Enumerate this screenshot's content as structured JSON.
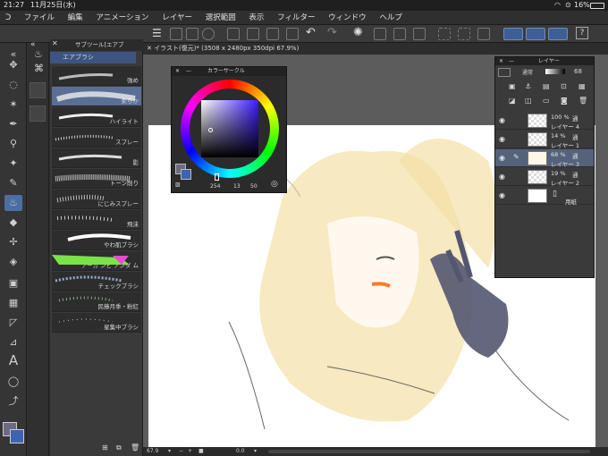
{
  "status": {
    "time": "21:27",
    "date": "11月25日(水)",
    "battery": "16%"
  },
  "menu": [
    "ファイル",
    "編集",
    "アニメーション",
    "レイヤー",
    "選択範囲",
    "表示",
    "フィルター",
    "ウィンドウ",
    "ヘルプ"
  ],
  "subtool_panel": {
    "header": "サブツール[エアブ",
    "group": "エアブラシ",
    "brushes": [
      "強め",
      "柔らか",
      "ハイライト",
      "スプレー",
      "影",
      "トーン削り",
      "にじみスプレー",
      "飛沫",
      "やわ肌ブラシ",
      "アーガ ンピ アンダ ム",
      "チェックブラシ",
      "民藤月季・粉紅",
      "星集中ブラシ"
    ],
    "selected_index": 1
  },
  "document_tab": "イラスト(復元)* (3508 x 2480px 350dpi 67.9%)",
  "color_panel": {
    "title": "カラーサークル",
    "h": "254",
    "s": "13",
    "v": "50",
    "main_color": "#6b6b84"
  },
  "layer_panel": {
    "title": "レイヤー",
    "blend": "通常",
    "opacity": "68",
    "layers": [
      {
        "pct": "100 %",
        "mode": "通",
        "name": "レイヤー 4",
        "kind": "transparent"
      },
      {
        "pct": "14 %",
        "mode": "通",
        "name": "レイヤー 1",
        "kind": "transparent"
      },
      {
        "pct": "68 %",
        "mode": "通",
        "name": "レイヤー 3",
        "kind": "sketch"
      },
      {
        "pct": "19 %",
        "mode": "通",
        "name": "レイヤー 2",
        "kind": "transparent"
      },
      {
        "pct": "",
        "mode": "",
        "name": "用紙",
        "kind": "paper"
      }
    ],
    "selected_index": 2
  },
  "footer": {
    "zoom": "67.9",
    "rotate": "0.0"
  }
}
